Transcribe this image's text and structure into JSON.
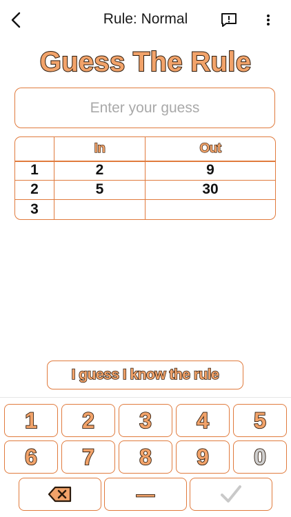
{
  "header": {
    "title": "Rule: Normal",
    "back_icon": "chevron-left-icon",
    "feedback_icon": "feedback-icon",
    "menu_icon": "more-vertical-icon"
  },
  "game": {
    "heading": "Guess The Rule",
    "guess_placeholder": "Enter your guess",
    "guess_value": ""
  },
  "table": {
    "columns": [
      "",
      "In",
      "Out"
    ],
    "rows": [
      {
        "index": "1",
        "in": "2",
        "out": "9"
      },
      {
        "index": "2",
        "in": "5",
        "out": "30"
      },
      {
        "index": "3",
        "in": "",
        "out": ""
      }
    ]
  },
  "know_rule_label": "I guess I know the rule",
  "keypad": {
    "digits_row1": [
      "1",
      "2",
      "3",
      "4",
      "5"
    ],
    "digits_row2": [
      "6",
      "7",
      "8",
      "9",
      "0"
    ],
    "backspace_icon": "backspace-icon",
    "minus_label": "—",
    "submit_icon": "checkmark-icon"
  },
  "colors": {
    "accent": "#e07a3c",
    "digit_fill": "#f2a36a",
    "disabled": "#cfcfcf"
  }
}
